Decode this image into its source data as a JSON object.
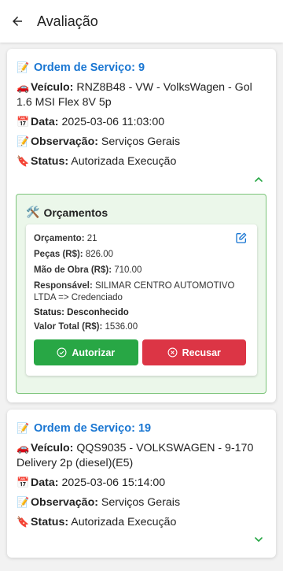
{
  "appbar": {
    "title": "Avaliação",
    "back_icon": "arrow-left-icon"
  },
  "colors": {
    "accent": "#1976d2",
    "success": "#28a745",
    "danger": "#dc3545",
    "orcamento_bg": "#ebf7ea",
    "orcamento_border": "#7cc47a"
  },
  "orders": [
    {
      "title": "Ordem de Serviço: 9",
      "veiculo_label": "Veículo:",
      "veiculo": "RNZ8B48 - VW - VolksWagen - Gol 1.6 MSI Flex 8V 5p",
      "data_label": "Data:",
      "data": "2025-03-06 11:03:00",
      "obs_label": "Observação:",
      "obs": "Serviços Gerais",
      "status_label": "Status:",
      "status": "Autorizada Execução",
      "expanded": true,
      "orcamentos_title": "Orçamentos",
      "orcamento": {
        "numero_label": "Orçamento:",
        "numero": "21",
        "pecas_label": "Peças (R$):",
        "pecas": "826.00",
        "mao_label": "Mão de Obra (R$):",
        "mao": "710.00",
        "resp_label": "Responsável:",
        "resp": "SILIMAR CENTRO AUTOMOTIVO LTDA => Credenciado",
        "status": "Status: Desconhecido",
        "total_label": "Valor Total (R$):",
        "total": "1536.00",
        "autorizar": "Autorizar",
        "recusar": "Recusar"
      }
    },
    {
      "title": "Ordem de Serviço: 19",
      "veiculo_label": "Veículo:",
      "veiculo": "QQS9035 - VOLKSWAGEN - 9-170 Delivery 2p (diesel)(E5)",
      "data_label": "Data:",
      "data": "2025-03-06 15:14:00",
      "obs_label": "Observação:",
      "obs": "Serviços Gerais",
      "status_label": "Status:",
      "status": "Autorizada Execução",
      "expanded": false
    }
  ]
}
